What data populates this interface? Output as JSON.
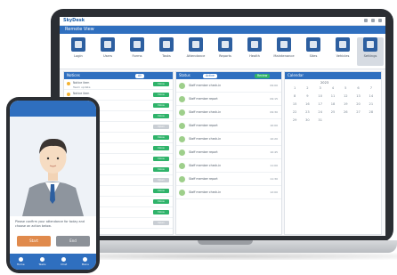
{
  "app": {
    "brand": "SkyDesk",
    "menu_label": "Remote View"
  },
  "toolbar": {
    "items": [
      {
        "label": "Login",
        "icon": "login-icon"
      },
      {
        "label": "Users",
        "icon": "users-icon"
      },
      {
        "label": "Forms",
        "icon": "forms-icon"
      },
      {
        "label": "Tasks",
        "icon": "tasks-icon"
      },
      {
        "label": "Attendance",
        "icon": "pen-icon"
      },
      {
        "label": "Reports",
        "icon": "report-icon"
      },
      {
        "label": "Health",
        "icon": "heart-icon"
      },
      {
        "label": "Maintenance",
        "icon": "tools-icon"
      },
      {
        "label": "Sites",
        "icon": "pin-icon"
      },
      {
        "label": "Vehicles",
        "icon": "truck-icon"
      },
      {
        "label": "Settings",
        "icon": "gear-icon"
      }
    ]
  },
  "left_panel": {
    "title": "Notices",
    "filter": "All",
    "rows": [
      {
        "line1": "Notice item",
        "line2": "Team update",
        "badge": "Done"
      },
      {
        "line1": "Notice item",
        "line2": "Team update",
        "badge": "Done"
      },
      {
        "line1": "Notice item",
        "line2": "Team update",
        "badge": "Done"
      },
      {
        "line1": "Notice item",
        "line2": "Team update",
        "badge": "Done"
      },
      {
        "line1": "Notice item",
        "line2": "Team update",
        "badge": "Open"
      },
      {
        "line1": "Notice item",
        "line2": "Team update",
        "badge": "Done"
      },
      {
        "line1": "Notice item",
        "line2": "Team update",
        "badge": "Done"
      },
      {
        "line1": "Notice item",
        "line2": "Team update",
        "badge": "Done"
      },
      {
        "line1": "Notice item",
        "line2": "Team update",
        "badge": "Done"
      },
      {
        "line1": "Notice item",
        "line2": "Team update",
        "badge": "Open"
      },
      {
        "line1": "Notice item",
        "line2": "Team update",
        "badge": "Done"
      },
      {
        "line1": "Notice item",
        "line2": "Team update",
        "badge": "Done"
      },
      {
        "line1": "Notice item",
        "line2": "Team update",
        "badge": "Done"
      },
      {
        "line1": "Notice item",
        "line2": "Team update",
        "badge": "Open"
      }
    ]
  },
  "mid_panel": {
    "title": "Status",
    "chip_a": "Active",
    "chip_b": "Review",
    "rows": [
      {
        "text": "Staff member check-in",
        "right": "09:00"
      },
      {
        "text": "Staff member report",
        "right": "09:15"
      },
      {
        "text": "Staff member check-in",
        "right": "09:30"
      },
      {
        "text": "Staff member report",
        "right": "10:00"
      },
      {
        "text": "Staff member check-in",
        "right": "10:20"
      },
      {
        "text": "Staff member report",
        "right": "10:45"
      },
      {
        "text": "Staff member check-in",
        "right": "11:00"
      },
      {
        "text": "Staff member report",
        "right": "11:30"
      },
      {
        "text": "Staff member check-in",
        "right": "12:00"
      }
    ]
  },
  "right_panel": {
    "title": "Calendar",
    "month": "2023",
    "days": [
      "1",
      "2",
      "3",
      "4",
      "5",
      "6",
      "7",
      "8",
      "9",
      "10",
      "11",
      "12",
      "13",
      "14",
      "15",
      "16",
      "17",
      "18",
      "19",
      "20",
      "21",
      "22",
      "23",
      "24",
      "25",
      "26",
      "27",
      "28",
      "29",
      "30",
      "31"
    ]
  },
  "phone": {
    "message": "Please confirm your attendance for today and choose an action below.",
    "btn_ok": "Start",
    "btn_cancel": "End",
    "nav": [
      "Home",
      "Tasks",
      "Chat",
      "Menu"
    ]
  }
}
